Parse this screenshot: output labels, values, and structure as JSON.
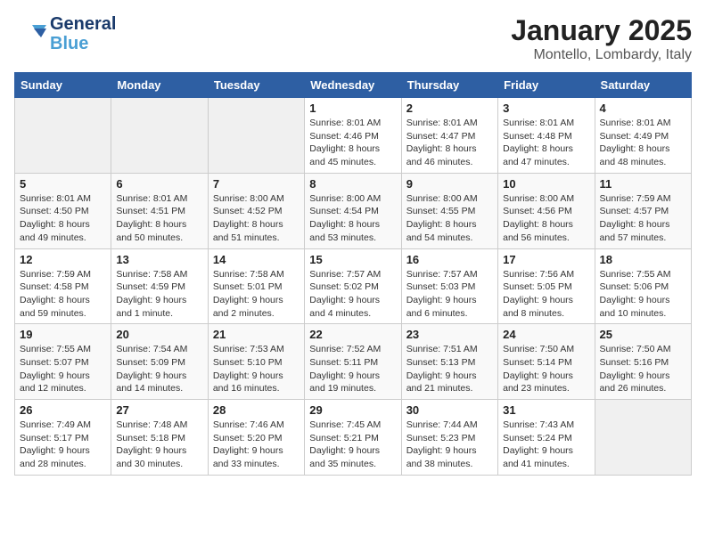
{
  "header": {
    "logo_line1": "General",
    "logo_line2": "Blue",
    "month": "January 2025",
    "location": "Montello, Lombardy, Italy"
  },
  "days_of_week": [
    "Sunday",
    "Monday",
    "Tuesday",
    "Wednesday",
    "Thursday",
    "Friday",
    "Saturday"
  ],
  "weeks": [
    [
      {
        "day": "",
        "info": ""
      },
      {
        "day": "",
        "info": ""
      },
      {
        "day": "",
        "info": ""
      },
      {
        "day": "1",
        "info": "Sunrise: 8:01 AM\nSunset: 4:46 PM\nDaylight: 8 hours\nand 45 minutes."
      },
      {
        "day": "2",
        "info": "Sunrise: 8:01 AM\nSunset: 4:47 PM\nDaylight: 8 hours\nand 46 minutes."
      },
      {
        "day": "3",
        "info": "Sunrise: 8:01 AM\nSunset: 4:48 PM\nDaylight: 8 hours\nand 47 minutes."
      },
      {
        "day": "4",
        "info": "Sunrise: 8:01 AM\nSunset: 4:49 PM\nDaylight: 8 hours\nand 48 minutes."
      }
    ],
    [
      {
        "day": "5",
        "info": "Sunrise: 8:01 AM\nSunset: 4:50 PM\nDaylight: 8 hours\nand 49 minutes."
      },
      {
        "day": "6",
        "info": "Sunrise: 8:01 AM\nSunset: 4:51 PM\nDaylight: 8 hours\nand 50 minutes."
      },
      {
        "day": "7",
        "info": "Sunrise: 8:00 AM\nSunset: 4:52 PM\nDaylight: 8 hours\nand 51 minutes."
      },
      {
        "day": "8",
        "info": "Sunrise: 8:00 AM\nSunset: 4:54 PM\nDaylight: 8 hours\nand 53 minutes."
      },
      {
        "day": "9",
        "info": "Sunrise: 8:00 AM\nSunset: 4:55 PM\nDaylight: 8 hours\nand 54 minutes."
      },
      {
        "day": "10",
        "info": "Sunrise: 8:00 AM\nSunset: 4:56 PM\nDaylight: 8 hours\nand 56 minutes."
      },
      {
        "day": "11",
        "info": "Sunrise: 7:59 AM\nSunset: 4:57 PM\nDaylight: 8 hours\nand 57 minutes."
      }
    ],
    [
      {
        "day": "12",
        "info": "Sunrise: 7:59 AM\nSunset: 4:58 PM\nDaylight: 8 hours\nand 59 minutes."
      },
      {
        "day": "13",
        "info": "Sunrise: 7:58 AM\nSunset: 4:59 PM\nDaylight: 9 hours\nand 1 minute."
      },
      {
        "day": "14",
        "info": "Sunrise: 7:58 AM\nSunset: 5:01 PM\nDaylight: 9 hours\nand 2 minutes."
      },
      {
        "day": "15",
        "info": "Sunrise: 7:57 AM\nSunset: 5:02 PM\nDaylight: 9 hours\nand 4 minutes."
      },
      {
        "day": "16",
        "info": "Sunrise: 7:57 AM\nSunset: 5:03 PM\nDaylight: 9 hours\nand 6 minutes."
      },
      {
        "day": "17",
        "info": "Sunrise: 7:56 AM\nSunset: 5:05 PM\nDaylight: 9 hours\nand 8 minutes."
      },
      {
        "day": "18",
        "info": "Sunrise: 7:55 AM\nSunset: 5:06 PM\nDaylight: 9 hours\nand 10 minutes."
      }
    ],
    [
      {
        "day": "19",
        "info": "Sunrise: 7:55 AM\nSunset: 5:07 PM\nDaylight: 9 hours\nand 12 minutes."
      },
      {
        "day": "20",
        "info": "Sunrise: 7:54 AM\nSunset: 5:09 PM\nDaylight: 9 hours\nand 14 minutes."
      },
      {
        "day": "21",
        "info": "Sunrise: 7:53 AM\nSunset: 5:10 PM\nDaylight: 9 hours\nand 16 minutes."
      },
      {
        "day": "22",
        "info": "Sunrise: 7:52 AM\nSunset: 5:11 PM\nDaylight: 9 hours\nand 19 minutes."
      },
      {
        "day": "23",
        "info": "Sunrise: 7:51 AM\nSunset: 5:13 PM\nDaylight: 9 hours\nand 21 minutes."
      },
      {
        "day": "24",
        "info": "Sunrise: 7:50 AM\nSunset: 5:14 PM\nDaylight: 9 hours\nand 23 minutes."
      },
      {
        "day": "25",
        "info": "Sunrise: 7:50 AM\nSunset: 5:16 PM\nDaylight: 9 hours\nand 26 minutes."
      }
    ],
    [
      {
        "day": "26",
        "info": "Sunrise: 7:49 AM\nSunset: 5:17 PM\nDaylight: 9 hours\nand 28 minutes."
      },
      {
        "day": "27",
        "info": "Sunrise: 7:48 AM\nSunset: 5:18 PM\nDaylight: 9 hours\nand 30 minutes."
      },
      {
        "day": "28",
        "info": "Sunrise: 7:46 AM\nSunset: 5:20 PM\nDaylight: 9 hours\nand 33 minutes."
      },
      {
        "day": "29",
        "info": "Sunrise: 7:45 AM\nSunset: 5:21 PM\nDaylight: 9 hours\nand 35 minutes."
      },
      {
        "day": "30",
        "info": "Sunrise: 7:44 AM\nSunset: 5:23 PM\nDaylight: 9 hours\nand 38 minutes."
      },
      {
        "day": "31",
        "info": "Sunrise: 7:43 AM\nSunset: 5:24 PM\nDaylight: 9 hours\nand 41 minutes."
      },
      {
        "day": "",
        "info": ""
      }
    ]
  ]
}
